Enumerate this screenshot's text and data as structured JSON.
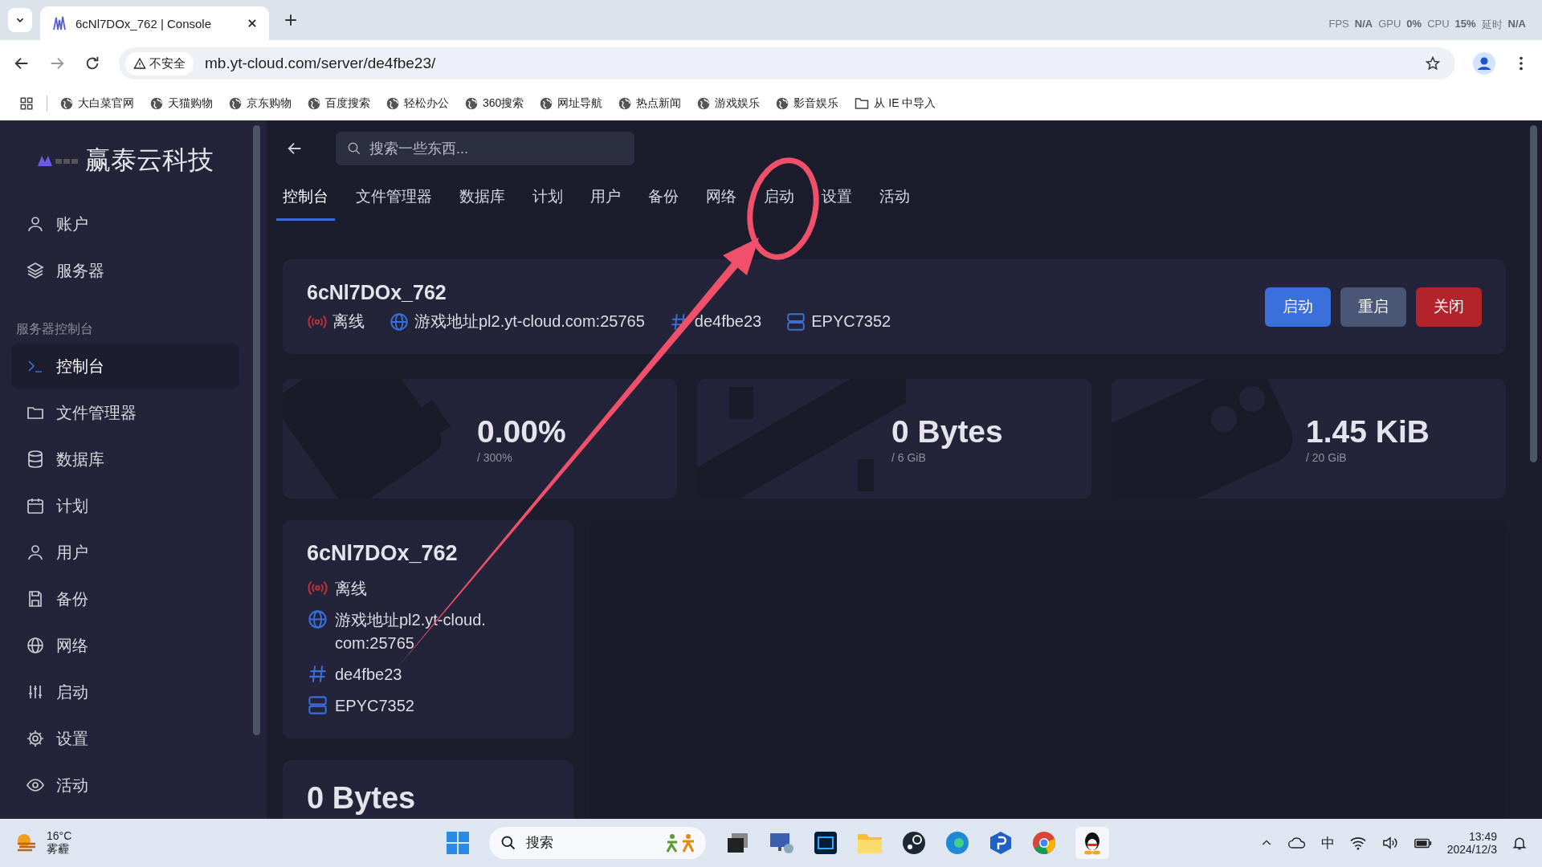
{
  "browser": {
    "tab_title": "6cNl7DOx_762 | Console",
    "insecure_label": "不安全",
    "url": "mb.yt-cloud.com/server/de4fbe23/",
    "perf_overlay": [
      "FPS",
      "N/A",
      "GPU",
      "0%",
      "CPU",
      "15%",
      "延时",
      "N/A"
    ],
    "bookmarks": [
      {
        "label": "大白菜官网",
        "kind": "site"
      },
      {
        "label": "天猫购物",
        "kind": "site"
      },
      {
        "label": "京东购物",
        "kind": "site"
      },
      {
        "label": "百度搜索",
        "kind": "site"
      },
      {
        "label": "轻松办公",
        "kind": "site"
      },
      {
        "label": "360搜索",
        "kind": "site"
      },
      {
        "label": "网址导航",
        "kind": "site"
      },
      {
        "label": "热点新闻",
        "kind": "site"
      },
      {
        "label": "游戏娱乐",
        "kind": "site"
      },
      {
        "label": "影音娱乐",
        "kind": "site"
      },
      {
        "label": "从 IE 中导入",
        "kind": "folder"
      }
    ]
  },
  "sidebar": {
    "brand": "赢泰云科技",
    "top_items": [
      {
        "label": "账户"
      },
      {
        "label": "服务器"
      }
    ],
    "section_title": "服务器控制台",
    "items": [
      {
        "label": "控制台",
        "selected": true
      },
      {
        "label": "文件管理器",
        "selected": false
      },
      {
        "label": "数据库",
        "selected": false
      },
      {
        "label": "计划",
        "selected": false
      },
      {
        "label": "用户",
        "selected": false
      },
      {
        "label": "备份",
        "selected": false
      },
      {
        "label": "网络",
        "selected": false
      },
      {
        "label": "启动",
        "selected": false
      },
      {
        "label": "设置",
        "selected": false
      },
      {
        "label": "活动",
        "selected": false
      }
    ]
  },
  "search": {
    "placeholder": "搜索一些东西..."
  },
  "tabs": [
    {
      "label": "控制台",
      "selected": true
    },
    {
      "label": "文件管理器",
      "selected": false
    },
    {
      "label": "数据库",
      "selected": false
    },
    {
      "label": "计划",
      "selected": false
    },
    {
      "label": "用户",
      "selected": false
    },
    {
      "label": "备份",
      "selected": false
    },
    {
      "label": "网络",
      "selected": false
    },
    {
      "label": "启动",
      "selected": false
    },
    {
      "label": "设置",
      "selected": false
    },
    {
      "label": "活动",
      "selected": false
    }
  ],
  "server_header": {
    "name": "6cNl7DOx_762",
    "details": [
      {
        "kind": "status",
        "text": "离线"
      },
      {
        "kind": "address",
        "text": "游戏地址pl2.yt-cloud.com:25765"
      },
      {
        "kind": "id",
        "text": "de4fbe23"
      },
      {
        "kind": "cpu",
        "text": "EPYC7352"
      }
    ],
    "buttons": [
      {
        "label": "启动",
        "kind": "start"
      },
      {
        "label": "重启",
        "kind": "restart"
      },
      {
        "label": "关闭",
        "kind": "stop"
      }
    ]
  },
  "stats": [
    {
      "kind": "cpu",
      "value": "0.00%",
      "limit": "/ 300%"
    },
    {
      "kind": "memory",
      "value": "0 Bytes",
      "limit": "/ 6 GiB"
    },
    {
      "kind": "disk",
      "value": "1.45 KiB",
      "limit": "/ 20 GiB"
    }
  ],
  "info_card": {
    "name": "6cNl7DOx_762",
    "details": [
      {
        "kind": "status",
        "text": "离线"
      },
      {
        "kind": "address",
        "text": "游戏地址pl2.yt-cloud.com:25765"
      },
      {
        "kind": "id",
        "text": "de4fbe23"
      },
      {
        "kind": "cpu",
        "text": "EPYC7352"
      }
    ]
  },
  "lower_card": {
    "value": "0 Bytes"
  },
  "taskbar": {
    "temperature": "16°C",
    "weather": "雾霾",
    "search_placeholder": "搜索",
    "ime": "中",
    "time": "13:49",
    "date": "2024/12/3"
  }
}
